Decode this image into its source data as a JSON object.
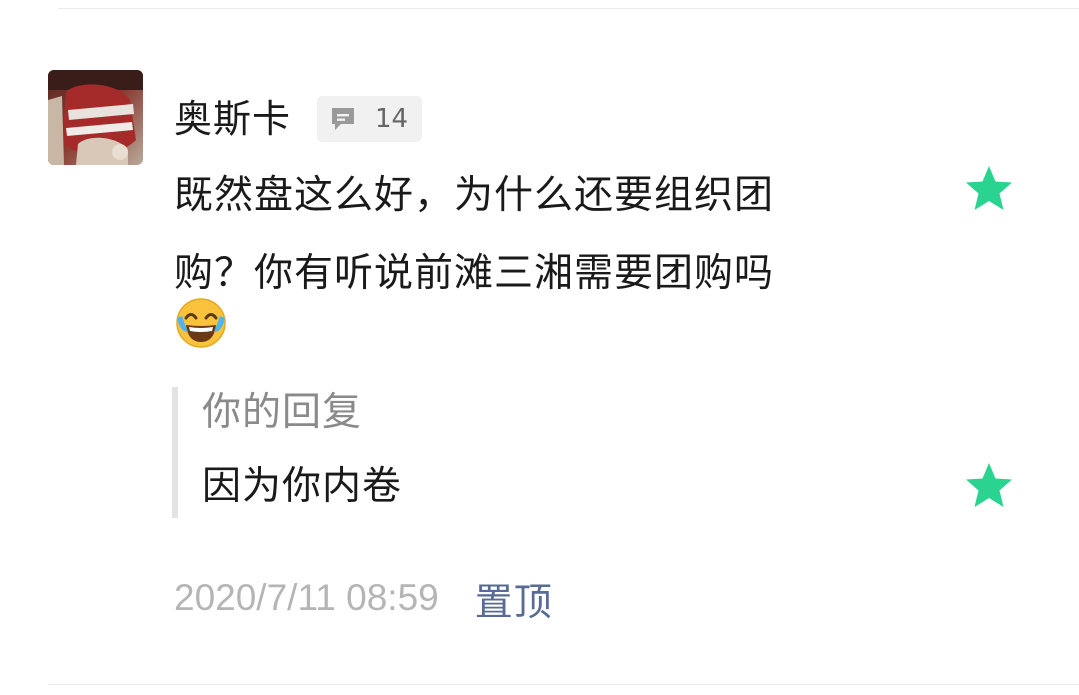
{
  "comment": {
    "username": "奥斯卡",
    "reply_count": "14",
    "text_line1": "既然盘这么好，为什么还要组织团",
    "text_line2": "购？你有听说前滩三湘需要团购吗",
    "emoji": "face-with-tears-of-joy-emoji"
  },
  "reply": {
    "label": "你的回复",
    "text": "因为你内卷"
  },
  "footer": {
    "timestamp": "2020/7/11 08:59",
    "pin_label": "置顶"
  },
  "colors": {
    "star": "#2ad38f",
    "link": "#576b95",
    "timestamp": "#b5b5b5",
    "badge_bg": "#f1f1f1"
  },
  "icons": {
    "reply_badge": "comment-bubble-icon",
    "featured": "star-icon"
  }
}
